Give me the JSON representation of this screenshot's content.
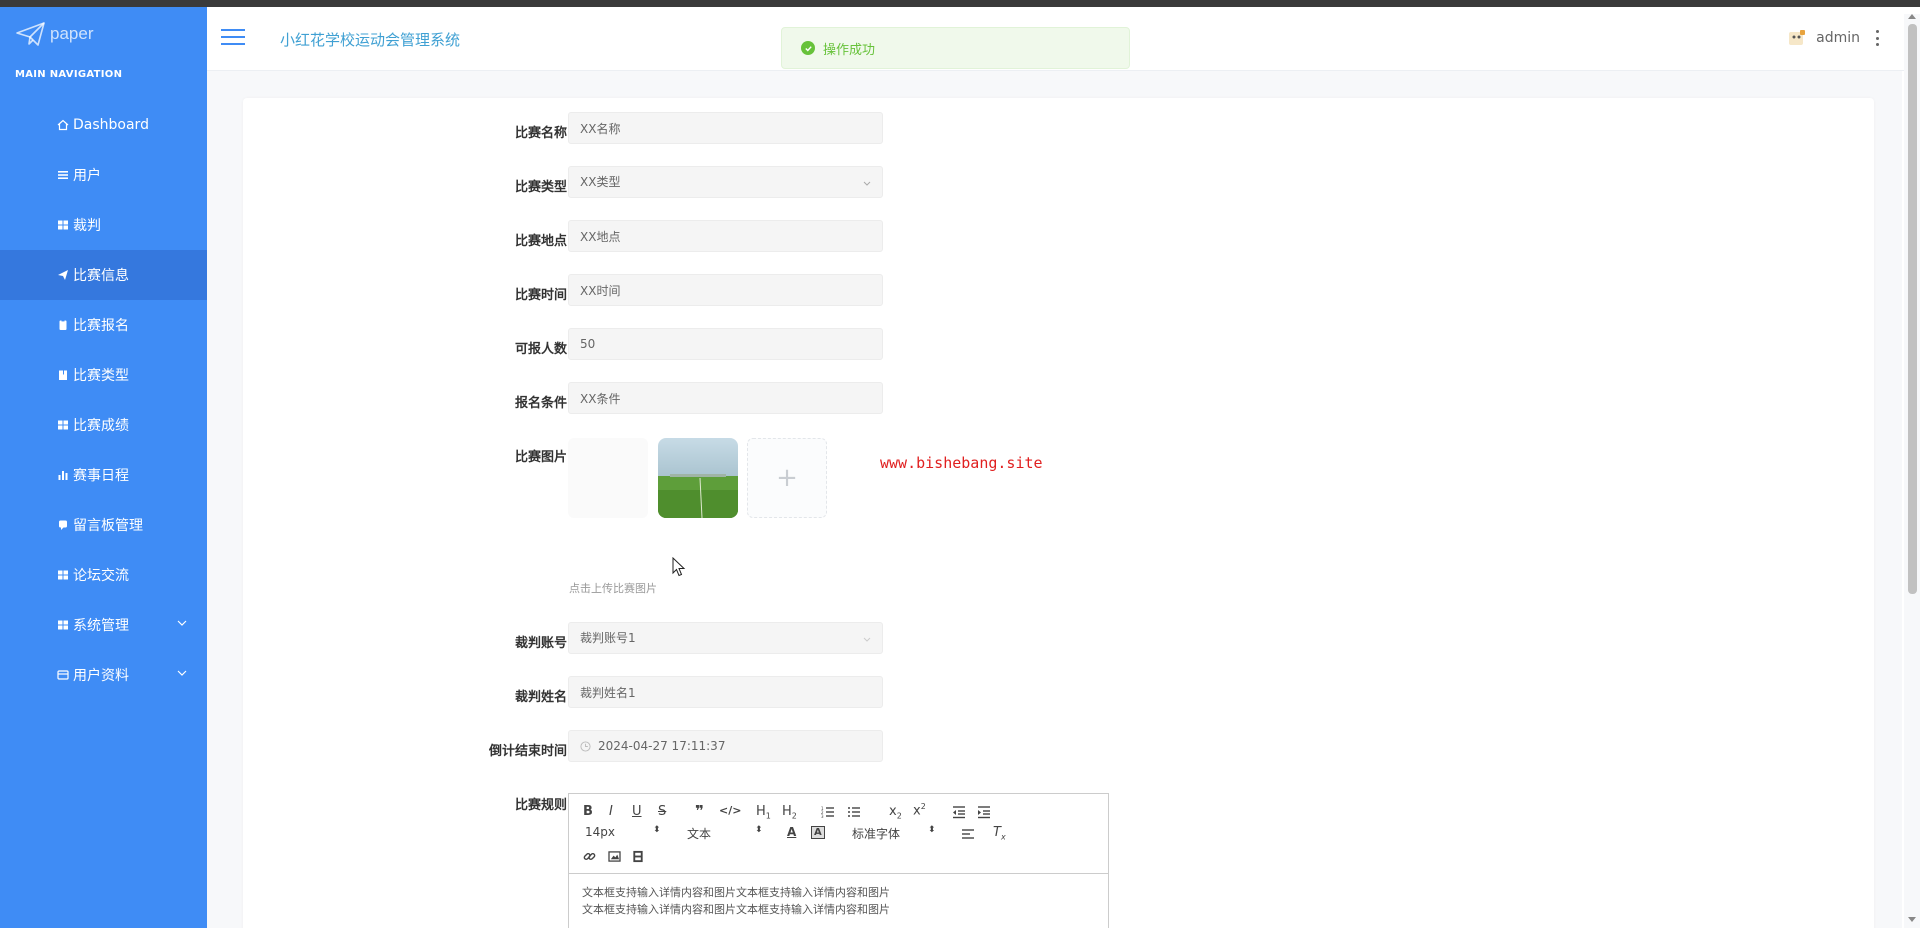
{
  "logo": {
    "text": "paper"
  },
  "sidebar": {
    "section_title": "MAIN NAVIGATION",
    "items": [
      {
        "label": "Dashboard",
        "icon": "home-icon"
      },
      {
        "label": "用户",
        "icon": "list-icon"
      },
      {
        "label": "裁判",
        "icon": "grid-icon"
      },
      {
        "label": "比赛信息",
        "icon": "send-icon",
        "active": true
      },
      {
        "label": "比赛报名",
        "icon": "clipboard-icon"
      },
      {
        "label": "比赛类型",
        "icon": "book-icon"
      },
      {
        "label": "比赛成绩",
        "icon": "grid-icon"
      },
      {
        "label": "赛事日程",
        "icon": "bar-chart-icon"
      },
      {
        "label": "留言板管理",
        "icon": "chat-icon"
      },
      {
        "label": "论坛交流",
        "icon": "grid-icon"
      },
      {
        "label": "系统管理",
        "icon": "grid-icon",
        "expandable": true
      },
      {
        "label": "用户资料",
        "icon": "card-icon",
        "expandable": true
      }
    ]
  },
  "header": {
    "system_title": "小红花学校运动会管理系统",
    "toast": "操作成功",
    "username": "admin"
  },
  "form": {
    "name": {
      "label": "比赛名称",
      "value": "XX名称"
    },
    "type": {
      "label": "比赛类型",
      "value": "XX类型"
    },
    "location": {
      "label": "比赛地点",
      "value": "XX地点"
    },
    "time": {
      "label": "比赛时间",
      "value": "XX时间"
    },
    "capacity": {
      "label": "可报人数",
      "value": "50"
    },
    "condition": {
      "label": "报名条件",
      "value": "XX条件"
    },
    "image": {
      "label": "比赛图片",
      "tip": "点击上传比赛图片"
    },
    "referee_account": {
      "label": "裁判账号",
      "value": "裁判账号1"
    },
    "referee_name": {
      "label": "裁判姓名",
      "value": "裁判姓名1"
    },
    "countdown": {
      "label": "倒计结束时间",
      "value": "2024-04-27 17:11:37"
    },
    "rules": {
      "label": "比赛规则",
      "toolbar": {
        "font_size": "14px",
        "text_type": "文本",
        "font_family": "标准字体"
      },
      "content_line1": "文本框支持输入详情内容和图片文本框支持输入详情内容和图片",
      "content_line2": "文本框支持输入详情内容和图片文本框支持输入详情内容和图片"
    }
  },
  "watermark": "www.bishebang.site",
  "colors": {
    "sidebar_bg": "#3f8cf5",
    "sidebar_active": "#3578de",
    "title": "#3fa0d3",
    "success": "#67c23a",
    "watermark": "#e02020"
  }
}
